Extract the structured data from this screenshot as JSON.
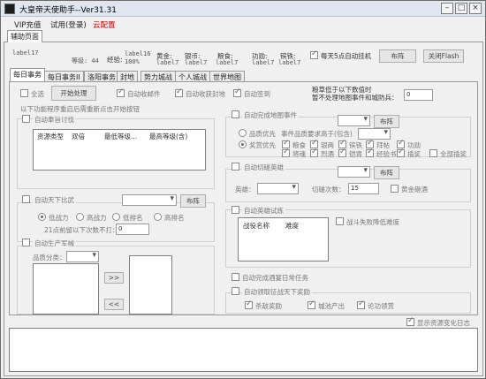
{
  "window": {
    "title": "大皇帝天使助手--Ver31.31",
    "min": "–",
    "max": "□",
    "close": "×"
  },
  "menu": [
    {
      "label": "VIP充值"
    },
    {
      "label": "试用(登录)"
    },
    {
      "label": "云配置"
    }
  ],
  "top_tab": "辅助页面",
  "account": {
    "label17": "label17",
    "level": "等级: 44",
    "exp_label": "经验:",
    "exp_value": "label16",
    "exp_percent": "100%",
    "gold_label": "黄金:",
    "silver_label": "银币:",
    "food_label": "粮食:",
    "merit_label": "功勋:",
    "iron_label": "镔铁:",
    "gold_val": "label7",
    "silver_val": "label7",
    "food_val": "label7",
    "merit_val": "label7",
    "iron_val": "label7",
    "auto_hang": "每天5点自动挂机",
    "layout_btn": "布阵",
    "close_flash_btn": "关闭Flash"
  },
  "tabs": [
    {
      "label": "每日事务"
    },
    {
      "label": "每日事务II"
    },
    {
      "label": "洛阳事务"
    },
    {
      "label": "封地"
    },
    {
      "label": "势力城战"
    },
    {
      "label": "个人城战"
    },
    {
      "label": "世界地图"
    }
  ],
  "daily": {
    "select_all": "全选",
    "start_btn": "开始处理",
    "auto_mail": "自动收邮件",
    "auto_fief": "自动收获封地",
    "auto_signin": "自动签到",
    "grain_note": "粮草低于以下数值时",
    "grain_note2": "暂不处理地图事件和城防兵：",
    "grain_value": "0",
    "restart_note": "以下功能程序重启后需重新点击开始按钮",
    "auto_bounty": "自动奉旨讨伐",
    "bounty_headers": [
      "资源类型",
      "双倍",
      "最低等级...",
      "最高等级(含)"
    ],
    "auto_world_battle": "自动天下比武",
    "world_layout_btn": "布阵",
    "rank_options": [
      "低战力",
      "高战力",
      "低排名",
      "高排名"
    ],
    "refresh_label": "21点前留以下次数不打：",
    "refresh_value": "0",
    "auto_production": "自动生产军械",
    "quality_label": "品质分类：",
    "move_right": ">>",
    "move_left": "<<",
    "auto_map_event": "自动完成地图事件",
    "map_layout_btn": "布阵",
    "quality_first": "品质优先",
    "event_quality_req": "事件品质要求高于(包含)",
    "reward_first": "奖赏优先",
    "rewards": [
      "粮食",
      "银两",
      "镔铁",
      "拜帖",
      "功勋",
      "将魂",
      "烈酒",
      "铠胄",
      "经验书",
      "插奖"
    ],
    "all_rewards": "全部插奖",
    "auto_cut": "自动切磋英雄",
    "cut_layout_btn": "布阵",
    "hero_label": "英雄：",
    "cut_times_label": "切磋次数：",
    "cut_times_value": "15",
    "gold_cut": "黄金砸酒",
    "auto_hero_trial": "自动英雄试炼",
    "trial_headers": [
      "战役名称",
      "难度"
    ],
    "fail_lower": "战斗失败降低难度",
    "auto_daily_task": "自动完成酒宴日常任务",
    "auto_conquest": "自动领取征战天下奖励",
    "conquest_items": [
      "杀敌奖励",
      "城池产出",
      "论功领赏"
    ],
    "show_log": "显示资源变化日志"
  }
}
